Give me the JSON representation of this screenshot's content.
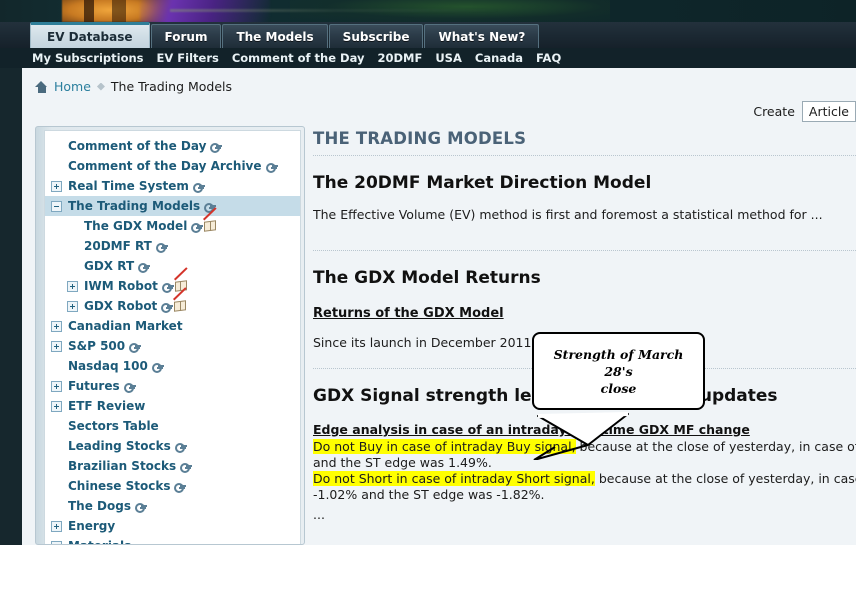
{
  "banner": {
    "alt": "site-banner-graphic"
  },
  "tabs": [
    {
      "label": "EV Database",
      "active": true
    },
    {
      "label": "Forum",
      "active": false
    },
    {
      "label": "The Models",
      "active": false
    },
    {
      "label": "Subscribe",
      "active": false
    },
    {
      "label": "What's New?",
      "active": false
    }
  ],
  "subnav": [
    {
      "label": "My Subscriptions"
    },
    {
      "label": "EV Filters"
    },
    {
      "label": "Comment of the Day"
    },
    {
      "label": "20DMF"
    },
    {
      "label": "USA"
    },
    {
      "label": "Canada"
    },
    {
      "label": "FAQ"
    }
  ],
  "breadcrumb": {
    "home": "Home",
    "current": "The Trading Models"
  },
  "create": {
    "label": "Create",
    "selected": "Article"
  },
  "sidebar": {
    "items": [
      {
        "label": "Comment of the Day",
        "indent": 0,
        "expander": "none",
        "key": true,
        "book": false,
        "selected": false
      },
      {
        "label": "Comment of the Day Archive",
        "indent": 0,
        "expander": "none",
        "key": true,
        "book": false,
        "selected": false
      },
      {
        "label": "Real Time System",
        "indent": 0,
        "expander": "plus",
        "key": true,
        "book": false,
        "selected": false
      },
      {
        "label": "The Trading Models",
        "indent": 0,
        "expander": "minus",
        "key": true,
        "book": false,
        "selected": true
      },
      {
        "label": "The GDX Model",
        "indent": 1,
        "expander": "none",
        "key": true,
        "book": true,
        "selected": false
      },
      {
        "label": "20DMF RT",
        "indent": 1,
        "expander": "none",
        "key": true,
        "book": false,
        "selected": false
      },
      {
        "label": "GDX RT",
        "indent": 1,
        "expander": "none",
        "key": true,
        "book": false,
        "selected": false
      },
      {
        "label": "IWM Robot",
        "indent": 1,
        "expander": "plus",
        "key": true,
        "book": true,
        "selected": false
      },
      {
        "label": "GDX Robot",
        "indent": 1,
        "expander": "plus",
        "key": true,
        "book": true,
        "selected": false
      },
      {
        "label": "Canadian Market",
        "indent": 0,
        "expander": "plus",
        "key": false,
        "book": false,
        "selected": false
      },
      {
        "label": "S&P 500",
        "indent": 0,
        "expander": "plus",
        "key": true,
        "book": false,
        "selected": false
      },
      {
        "label": "Nasdaq 100",
        "indent": 0,
        "expander": "none",
        "key": true,
        "book": false,
        "selected": false
      },
      {
        "label": "Futures",
        "indent": 0,
        "expander": "plus",
        "key": true,
        "book": false,
        "selected": false
      },
      {
        "label": "ETF Review",
        "indent": 0,
        "expander": "plus",
        "key": false,
        "book": false,
        "selected": false
      },
      {
        "label": "Sectors Table",
        "indent": 0,
        "expander": "none",
        "key": false,
        "book": false,
        "selected": false
      },
      {
        "label": "Leading Stocks",
        "indent": 0,
        "expander": "none",
        "key": true,
        "book": false,
        "selected": false
      },
      {
        "label": "Brazilian Stocks",
        "indent": 0,
        "expander": "none",
        "key": true,
        "book": false,
        "selected": false
      },
      {
        "label": "Chinese Stocks",
        "indent": 0,
        "expander": "none",
        "key": true,
        "book": false,
        "selected": false
      },
      {
        "label": "The Dogs",
        "indent": 0,
        "expander": "none",
        "key": true,
        "book": false,
        "selected": false
      },
      {
        "label": "Energy",
        "indent": 0,
        "expander": "plus",
        "key": false,
        "book": false,
        "selected": false
      },
      {
        "label": "Materials",
        "indent": 0,
        "expander": "plus",
        "key": false,
        "book": false,
        "selected": false
      }
    ]
  },
  "main": {
    "page_title": "THE TRADING MODELS",
    "section1": {
      "heading": "The 20DMF Market Direction Model",
      "text": "The Effective Volume (EV) method is first and foremost a statistical method for ..."
    },
    "section2": {
      "heading": "The GDX Model Returns",
      "link": "Returns of the GDX Model",
      "text": "Since its launch in December 2011, as o"
    },
    "section3": {
      "heading": "GDX Signal strength level and real time updates",
      "subheading": "Edge analysis in case of an intraday real time GDX MF change",
      "line1_highlight": "Do not Buy in case of intraday Buy signal,",
      "line1_rest": " because at the close of yesterday, in case of a Buy signal",
      "line2": "and the ST edge was 1.49%.",
      "line3_highlight": "Do not Short in case of intraday Short signal,",
      "line3_rest": " because at the close of yesterday, in case of a Short",
      "line4": "-1.02% and the ST edge was -1.82%.",
      "ellipsis": "..."
    }
  },
  "callout": {
    "line1": "Strength of March 28's",
    "line2": "close"
  },
  "colors": {
    "highlight": "#ffff00",
    "link": "#2b7f9e",
    "sidebar_text": "#1c5a78",
    "selected_row": "#c5dce8",
    "banner_dark": "#12272b",
    "page_bg": "#f0f4f7"
  }
}
